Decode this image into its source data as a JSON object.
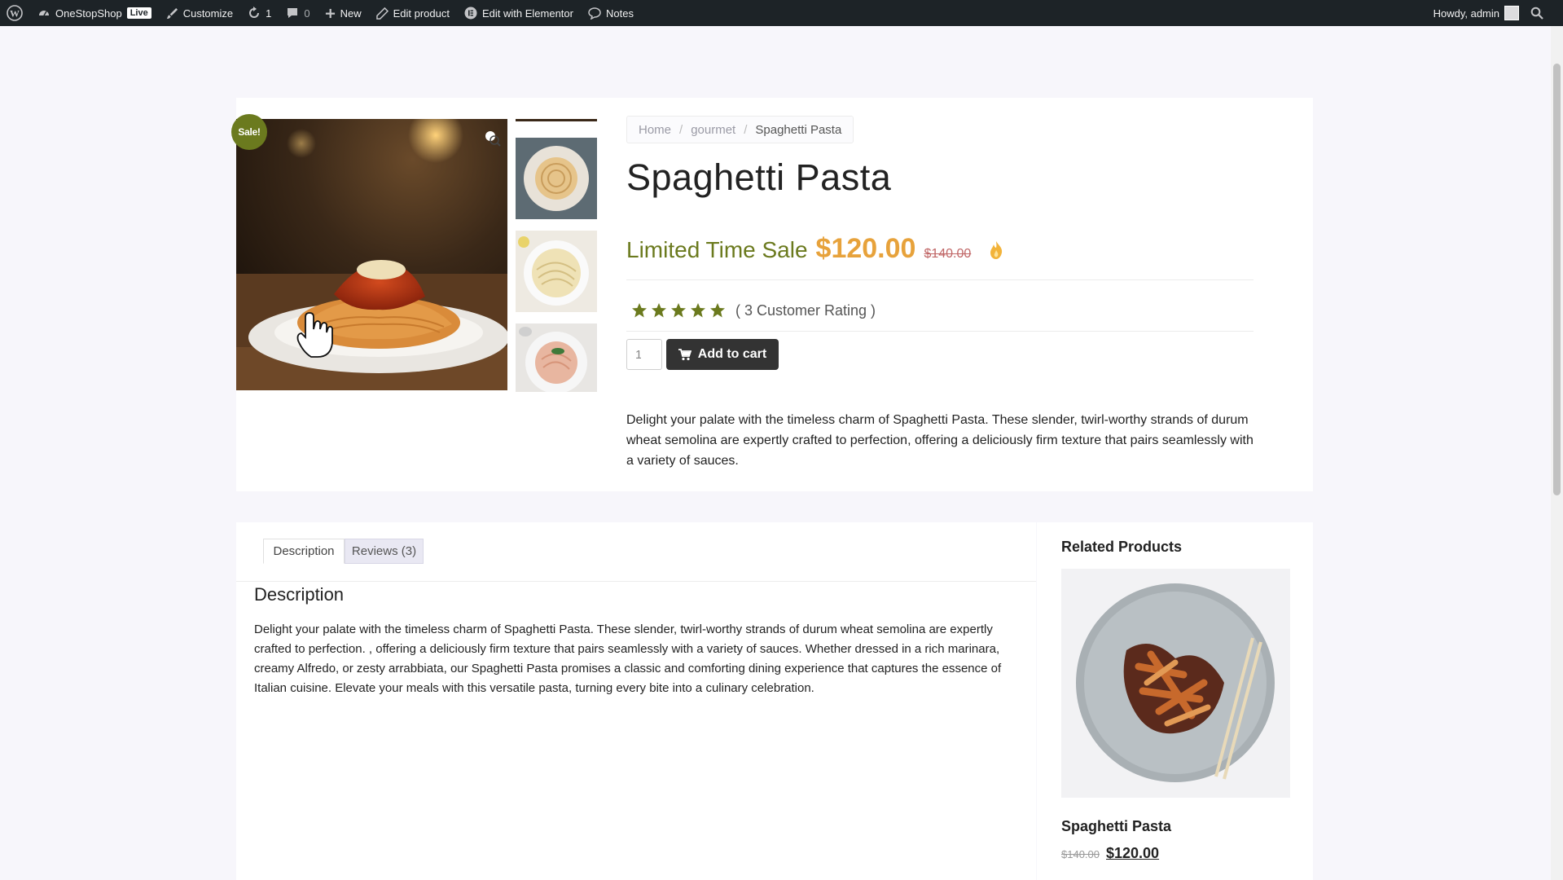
{
  "adminbar": {
    "site_name": "OneStopShop",
    "live_badge": "Live",
    "customize": "Customize",
    "updates_count": "1",
    "comments_count": "0",
    "new": "New",
    "edit_product": "Edit product",
    "edit_elementor": "Edit with Elementor",
    "notes": "Notes",
    "howdy": "Howdy, admin"
  },
  "product": {
    "sale_badge": "Sale!",
    "breadcrumb": [
      "Home",
      "gourmet",
      "Spaghetti Pasta"
    ],
    "breadcrumb_separator": "/",
    "title": "Spaghetti Pasta",
    "sale_label": "Limited Time Sale",
    "price_now": "$120.00",
    "price_old": "$140.00",
    "rating_stars": 5,
    "rating_text": "( 3 Customer Rating )",
    "quantity": "1",
    "add_to_cart": "Add to cart",
    "short_description": "Delight your palate with the timeless charm of Spaghetti Pasta. These slender, twirl-worthy strands of durum wheat semolina are expertly crafted to perfection, offering a deliciously firm texture that pairs seamlessly with a variety of sauces."
  },
  "tabs": {
    "description": "Description",
    "reviews": "Reviews (3)"
  },
  "description": {
    "heading": "Description",
    "body": "Delight your palate with the timeless charm of Spaghetti Pasta. These slender, twirl-worthy strands of durum wheat semolina are expertly crafted to perfection. , offering a deliciously firm texture that pairs seamlessly with a variety of sauces. Whether dressed in a rich marinara, creamy Alfredo, or zesty arrabbiata, our Spaghetti Pasta promises a classic and comforting dining experience that captures the essence of Italian cuisine. Elevate your meals with this versatile pasta, turning every bite into a culinary celebration."
  },
  "related": {
    "heading": "Related Products",
    "name": "Spaghetti Pasta",
    "price_old": "$140.00",
    "price_now": "$120.00"
  },
  "colors": {
    "accent_olive": "#6b7a1e",
    "price_orange": "#e7a23b",
    "adminbar_bg": "#1d2327"
  }
}
